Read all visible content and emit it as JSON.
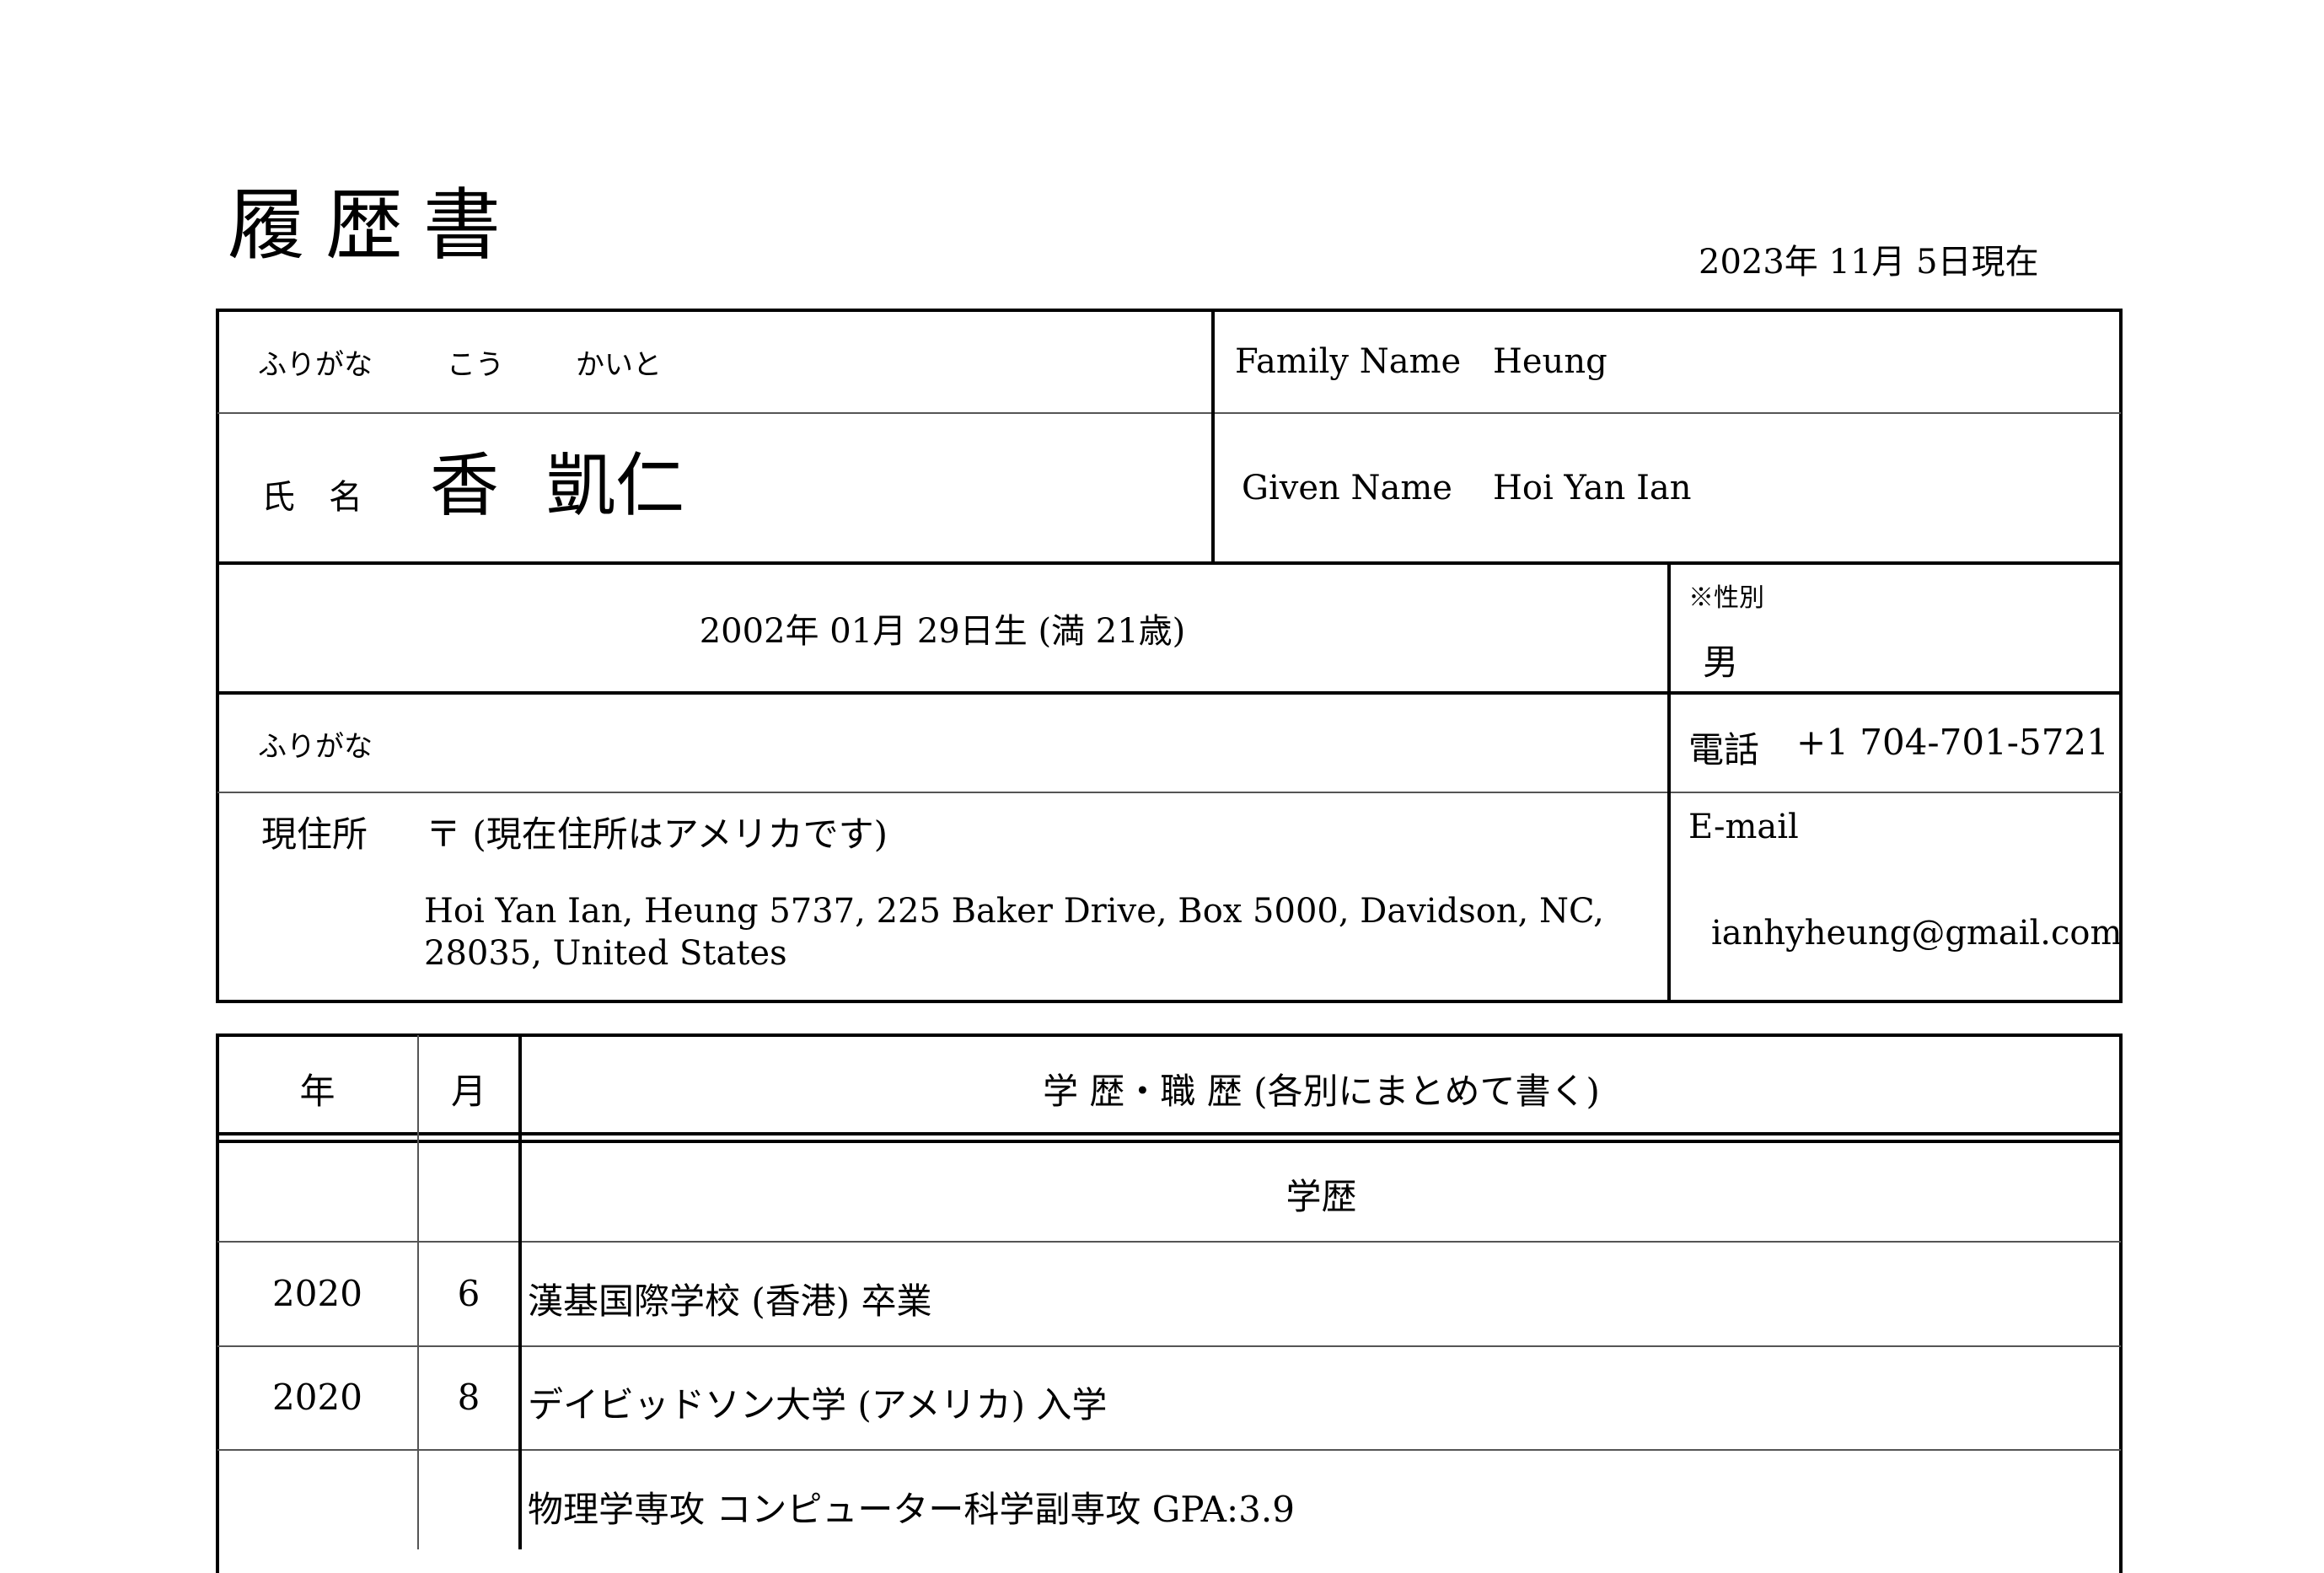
{
  "header": {
    "title": "履歴書",
    "as_of": "2023年 11月 5日現在"
  },
  "personal": {
    "furigana_label": "ふりがな",
    "furigana_family": "こう",
    "furigana_given": "かいと",
    "name_label": "氏　名",
    "name_family": "香",
    "name_given": "凱仁",
    "family_name_label": "Family Name",
    "family_name_value": "Heung",
    "given_name_label": "Given Name",
    "given_name_value": "Hoi Yan Ian",
    "birth": "2002年 01月 29日生 (満 21歳)",
    "gender_label": "※性別",
    "gender_value": "男",
    "addr_furigana_label": "ふりがな",
    "phone_label": "電話",
    "phone_value": "+1 704-701-5721",
    "address_label": "現住所",
    "postal": "〒 (現在住所はアメリカです)",
    "address_line1": "Hoi Yan Ian, Heung 5737, 225 Baker Drive, Box 5000, Davidson, NC,",
    "address_line2": "28035, United States",
    "email_label": "E-mail",
    "email_value": "ianhyheung@gmail.com"
  },
  "history": {
    "col_year": "年",
    "col_month": "月",
    "col_detail": "学 歴・職 歴 (各別にまとめて書く)",
    "section_label": "学歴",
    "rows": [
      {
        "year": "2020",
        "month": "6",
        "text": "漢基国際学校 (香港) 卒業"
      },
      {
        "year": "2020",
        "month": "8",
        "text": "デイビッドソン大学 (アメリカ) 入学"
      },
      {
        "year": "",
        "month": "",
        "text": "物理学専攻 コンピューター科学副専攻 GPA:3.9"
      }
    ]
  }
}
